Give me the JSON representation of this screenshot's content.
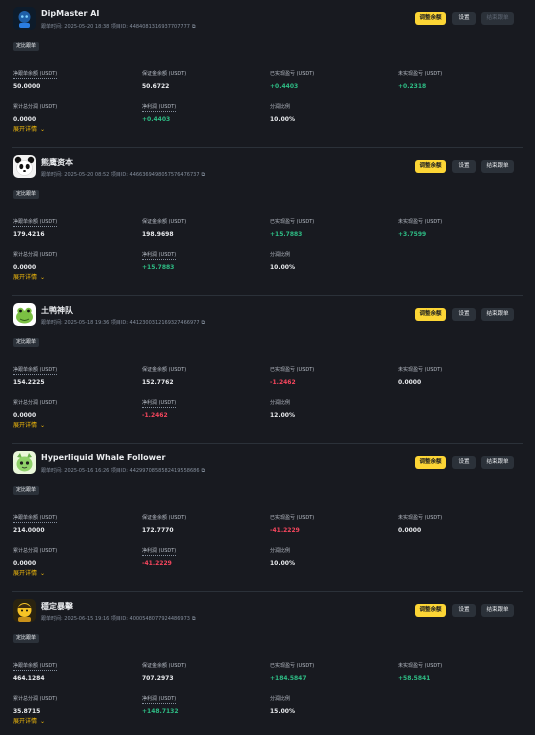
{
  "labels": {
    "net_transfer": "净跟单余额 (USDT)",
    "margin_balance": "保证金余额 (USDT)",
    "realized_pnl": "已实现盈亏 (USDT)",
    "unrealized_pnl": "未实现盈亏 (USDT)",
    "cum_profit_share": "累计总分润 (USDT)",
    "net_profit": "净利润 (USDT)",
    "share_ratio": "分润比例",
    "expand": "展开详情",
    "adjust_margin": "调整余额",
    "settings": "设置",
    "close_copy": "结束跟单",
    "tag": "定比跟单",
    "copy_mark": "⧉"
  },
  "cards": [
    {
      "name": "DipMaster AI",
      "meta": "跟单时间: 2025-05-20 18:38   项目ID: 4484081316937707777",
      "avatar": "robot-dip-icon",
      "close_disabled": true,
      "values": {
        "net_transfer": "50.0000",
        "margin_balance": "50.6722",
        "realized_pnl": "+0.4403",
        "unrealized_pnl": "+0.2318",
        "cum_profit_share": "0.0000",
        "net_profit": "+0.4403",
        "share_ratio": "10.00%"
      },
      "signs": {
        "realized_pnl": "pos",
        "unrealized_pnl": "pos",
        "net_profit": "pos"
      }
    },
    {
      "name": "熊鹰资本",
      "meta": "跟单时间: 2025-05-20 08:52   项目ID: 4466369498057576476737",
      "avatar": "panda-icon",
      "close_disabled": false,
      "values": {
        "net_transfer": "179.4216",
        "margin_balance": "198.9698",
        "realized_pnl": "+15.7883",
        "unrealized_pnl": "+3.7599",
        "cum_profit_share": "0.0000",
        "net_profit": "+15.7883",
        "share_ratio": "10.00%"
      },
      "signs": {
        "realized_pnl": "pos",
        "unrealized_pnl": "pos",
        "net_profit": "pos"
      }
    },
    {
      "name": "土鸭神队",
      "meta": "跟单时间: 2025-05-18 19:36   项目ID: 4412300312169327466977",
      "avatar": "frog-icon",
      "close_disabled": false,
      "values": {
        "net_transfer": "154.2225",
        "margin_balance": "152.7762",
        "realized_pnl": "-1.2462",
        "unrealized_pnl": "0.0000",
        "cum_profit_share": "0.0000",
        "net_profit": "-1.2462",
        "share_ratio": "12.00%"
      },
      "signs": {
        "realized_pnl": "neg",
        "unrealized_pnl": "neu",
        "net_profit": "neg"
      }
    },
    {
      "name": "Hyperliquid Whale Follower",
      "meta": "跟单时间: 2025-05-16 16:26   项目ID: 4429970858582419558686",
      "avatar": "green-creature-icon",
      "close_disabled": false,
      "values": {
        "net_transfer": "214.0000",
        "margin_balance": "172.7770",
        "realized_pnl": "-41.2229",
        "unrealized_pnl": "0.0000",
        "cum_profit_share": "0.0000",
        "net_profit": "-41.2229",
        "share_ratio": "10.00%"
      },
      "signs": {
        "realized_pnl": "neg",
        "unrealized_pnl": "neu",
        "net_profit": "neg"
      }
    },
    {
      "name": "穩定暴擊",
      "meta": "跟单时间: 2025-06-15 19:16   项目ID: 4000548077924486973",
      "avatar": "yellow-avatar-icon",
      "close_disabled": false,
      "values": {
        "net_transfer": "464.1284",
        "margin_balance": "707.2973",
        "realized_pnl": "+184.5847",
        "unrealized_pnl": "+58.5841",
        "cum_profit_share": "35.8715",
        "net_profit": "+148.7132",
        "share_ratio": "15.00%"
      },
      "signs": {
        "realized_pnl": "pos",
        "unrealized_pnl": "pos",
        "net_profit": "pos"
      }
    }
  ]
}
